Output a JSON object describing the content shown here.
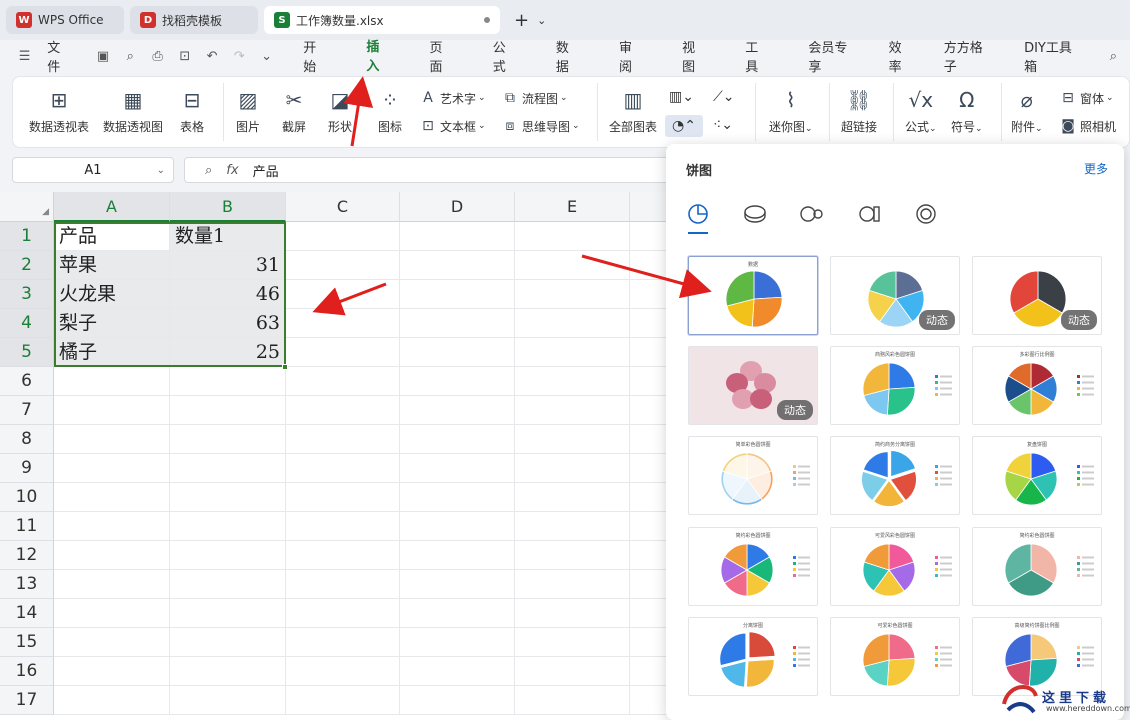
{
  "tabs": [
    {
      "label": "WPS Office",
      "color": "#d0312d",
      "glyph": "W"
    },
    {
      "label": "找稻壳模板",
      "color": "#d0312d",
      "glyph": "D"
    },
    {
      "label": "工作簿数量.xlsx",
      "color": "#1a7f37",
      "glyph": "S"
    }
  ],
  "menu": {
    "file": "文件",
    "items": [
      "开始",
      "插入",
      "页面",
      "公式",
      "数据",
      "审阅",
      "视图",
      "工具",
      "会员专享",
      "效率",
      "方方格子",
      "DIY工具箱"
    ],
    "active": "插入"
  },
  "ribbon": {
    "pivot_table": "数据透视表",
    "pivot_chart": "数据透视图",
    "table": "表格",
    "picture": "图片",
    "screenshot": "截屏",
    "shape": "形状",
    "icon": "图标",
    "wordart": "艺术字",
    "textbox": "文本框",
    "flowchart": "流程图",
    "mindmap": "思维导图",
    "all_charts": "全部图表",
    "sparkline": "迷你图",
    "hyperlink": "超链接",
    "formula": "公式",
    "symbol": "符号",
    "attachment": "附件",
    "form": "窗体",
    "camera": "照相机"
  },
  "formula_bar": {
    "cell_ref": "A1",
    "fx": "fx",
    "content": "产品"
  },
  "sheet": {
    "columns": [
      "A",
      "B",
      "C",
      "D",
      "E"
    ],
    "rows": [
      "1",
      "2",
      "3",
      "4",
      "5",
      "6",
      "7",
      "8",
      "9",
      "10",
      "11",
      "12",
      "13",
      "14",
      "15",
      "16",
      "17"
    ],
    "data": [
      [
        "产品",
        "数量1"
      ],
      [
        "苹果",
        "31"
      ],
      [
        "火龙果",
        "46"
      ],
      [
        "梨子",
        "63"
      ],
      [
        "橘子",
        "25"
      ]
    ]
  },
  "popup": {
    "title": "饼图",
    "more": "更多",
    "badge": "动态",
    "thumb_titles": [
      "數据",
      "",
      "",
      "",
      "商務风彩色圆饼图",
      "多彩图行比例图",
      "简单彩色圆饼图",
      "简约商务分离饼图",
      "复盘饼图",
      "简约彩色圆饼图",
      "可爱风彩色圆饼图",
      "简约彩色圆饼图",
      "分离饼图",
      "可爱彩色圆饼图",
      "高级简约饼图比例图"
    ]
  },
  "watermark": {
    "text": "这里下载",
    "url": "www.hereddown.com"
  }
}
